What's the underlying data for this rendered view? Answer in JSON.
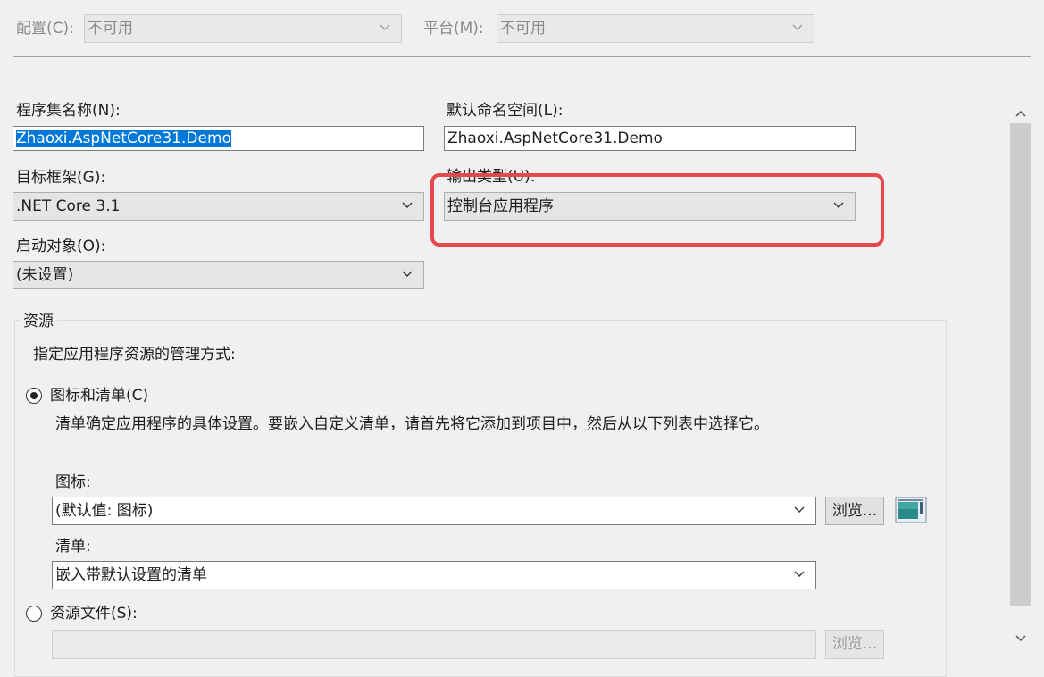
{
  "toolbar": {
    "config_label": "配置(C):",
    "config_value": "不可用",
    "platform_label": "平台(M):",
    "platform_value": "不可用"
  },
  "assembly": {
    "label": "程序集名称(N):",
    "value": "Zhaoxi.AspNetCore31.Demo"
  },
  "namespace": {
    "label": "默认命名空间(L):",
    "value": "Zhaoxi.AspNetCore31.Demo"
  },
  "target_framework": {
    "label": "目标框架(G):",
    "value": ".NET Core 3.1"
  },
  "output_type": {
    "label": "输出类型(U):",
    "value": "控制台应用程序"
  },
  "startup_object": {
    "label": "启动对象(O):",
    "value": "(未设置)"
  },
  "resources": {
    "group_title": "资源",
    "description": "指定应用程序资源的管理方式:",
    "icon_manifest_option": {
      "label": "图标和清单(C)",
      "selected": true,
      "help": "清单确定应用程序的具体设置。要嵌入自定义清单，请首先将它添加到项目中，然后从以下列表中选择它。"
    },
    "icon": {
      "label": "图标:",
      "value": "(默认值: 图标)",
      "browse_label": "浏览..."
    },
    "manifest": {
      "label": "清单:",
      "value": "嵌入带默认设置的清单"
    },
    "resource_file_option": {
      "label": "资源文件(S):",
      "selected": false,
      "browse_label": "浏览..."
    }
  },
  "colors": {
    "highlight": "#e5484d",
    "selection": "#0078d7"
  }
}
